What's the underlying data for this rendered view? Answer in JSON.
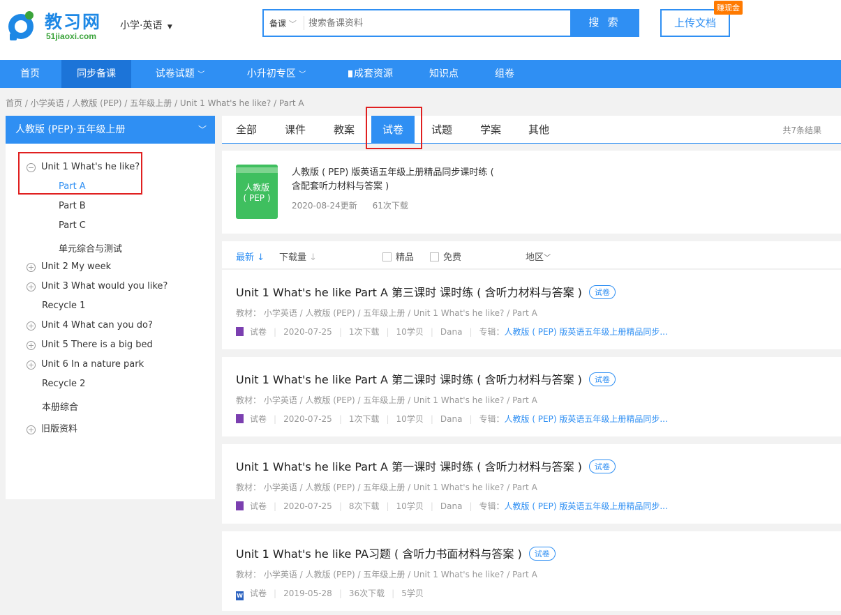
{
  "header": {
    "logo_name": "教习网",
    "logo_domain": "51jiaoxi.com",
    "subject_selector": "小学·英语",
    "search_type": "备课",
    "search_placeholder": "搜索备课资料",
    "search_button": "搜 索",
    "upload_button": "上传文档",
    "upload_badge": "赚现金"
  },
  "nav": {
    "items": [
      "首页",
      "同步备课",
      "试卷试题",
      "小升初专区",
      "成套资源",
      "知识点",
      "组卷"
    ],
    "active": "同步备课"
  },
  "breadcrumb": "首页 /  小学英语 / 人教版 (PEP) / 五年级上册 / Unit 1 What's he like? / Part A",
  "sidebar": {
    "heading": "人教版 (PEP)·五年级上册",
    "tree": [
      {
        "label": "Unit 1 What's he like?",
        "expander": "⊖"
      },
      {
        "label": "Part A",
        "selected": true
      },
      {
        "label": "Part B"
      },
      {
        "label": "Part C"
      },
      {
        "label": "单元综合与测试"
      },
      {
        "label": "Unit 2 My week",
        "expander": "⊕"
      },
      {
        "label": "Unit 3 What would you like?",
        "expander": "⊕"
      },
      {
        "label": "Recycle 1"
      },
      {
        "label": "Unit 4 What can you do?",
        "expander": "⊕"
      },
      {
        "label": "Unit 5 There is a big bed",
        "expander": "⊕"
      },
      {
        "label": "Unit 6 In a nature park",
        "expander": "⊕"
      },
      {
        "label": "Recycle 2"
      },
      {
        "label": "本册综合"
      },
      {
        "label": "旧版资料",
        "expander": "⊕"
      }
    ]
  },
  "tabs": {
    "items": [
      "全部",
      "课件",
      "教案",
      "试卷",
      "试题",
      "学案",
      "其他"
    ],
    "active": "试卷",
    "result_count": "共7条结果"
  },
  "featured": {
    "cover_text": "人教版\n( PEP )",
    "title": "人教版 ( PEP) 版英语五年级上册精品同步课时练 ( 含配套听力材料与答案 )",
    "date": "2020-08-24更新",
    "downloads": "61次下载"
  },
  "filters": {
    "latest": "最新",
    "downloads": "下载量",
    "premium": "精品",
    "free": "免费",
    "region": "地区"
  },
  "results": [
    {
      "title": "Unit 1 What's he like Part A 第三课时 课时练 ( 含听力材料与答案 )",
      "tag": "试卷",
      "path": "教材： 小学英语  /  人教版 (PEP)  /  五年级上册  /  Unit 1 What's he like?  /  Part A",
      "type": "试卷",
      "date": "2020-07-25",
      "downloads": "1次下载",
      "price": "10学贝",
      "author": "Dana",
      "album_label": "专辑：",
      "album": "人教版 ( PEP) 版英语五年级上册精品同步...",
      "file_icon": "purple-doc-icon"
    },
    {
      "title": "Unit 1 What's he like Part A 第二课时 课时练 ( 含听力材料与答案 )",
      "tag": "试卷",
      "path": "教材： 小学英语  /  人教版 (PEP)  /  五年级上册  /  Unit 1 What's he like?  /  Part A",
      "type": "试卷",
      "date": "2020-07-25",
      "downloads": "1次下载",
      "price": "10学贝",
      "author": "Dana",
      "album_label": "专辑：",
      "album": "人教版 ( PEP) 版英语五年级上册精品同步...",
      "file_icon": "purple-doc-icon"
    },
    {
      "title": "Unit 1 What's he like Part A 第一课时 课时练 ( 含听力材料与答案 )",
      "tag": "试卷",
      "path": "教材： 小学英语  /  人教版 (PEP)  /  五年级上册  /  Unit 1 What's he like?  /  Part A",
      "type": "试卷",
      "date": "2020-07-25",
      "downloads": "8次下载",
      "price": "10学贝",
      "author": "Dana",
      "album_label": "专辑：",
      "album": "人教版 ( PEP) 版英语五年级上册精品同步...",
      "file_icon": "purple-doc-icon"
    },
    {
      "title": "Unit 1 What's he like PA习题 ( 含听力书面材料与答案 )",
      "tag": "试卷",
      "path": "教材： 小学英语  /  人教版 (PEP)  /  五年级上册  /  Unit 1 What's he like?  /  Part A",
      "type": "试卷",
      "date": "2019-05-28",
      "downloads": "36次下载",
      "price": "5学贝",
      "file_icon": "word-doc-icon"
    }
  ],
  "colors": {
    "brand_blue": "#2f8ff3",
    "nav_active": "#1c74d8",
    "highlight_red": "#e02020",
    "badge_orange": "#ff7a00"
  }
}
